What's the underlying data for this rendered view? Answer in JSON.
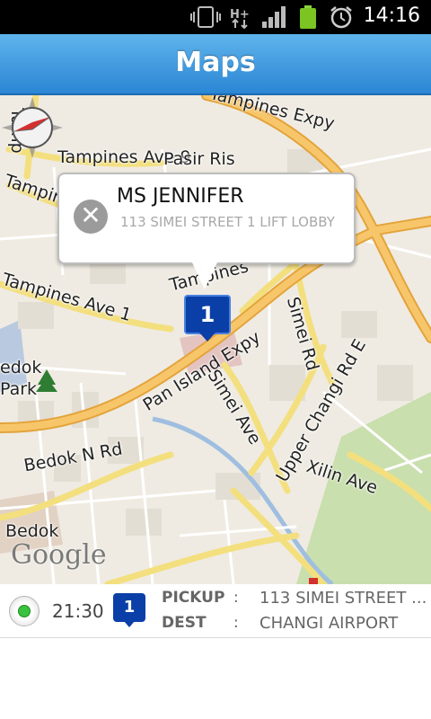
{
  "status_bar": {
    "time": "14:16"
  },
  "header": {
    "title": "Maps"
  },
  "map": {
    "labels": {
      "tampines_expy": "Tampines Expy",
      "tampines_ave9": "Tampines Ave 9",
      "pasir_ris": "Pasir Ris",
      "tampines_left": "Tampin",
      "tampines_ave1": "Tampines Ave 1",
      "tamp_mid": "Tampines",
      "pan_island": "Pan Island Expy",
      "simei_rd": "Simei Rd",
      "upper_changi": "Upper Changi Rd E",
      "simei_ave": "Simei Ave",
      "bedok_n_rd": "Bedok N Rd",
      "xilin_ave": "Xilin Ave",
      "bedok_park_1": "edok",
      "bedok_park_2": "Park",
      "bedok": "Bedok",
      "tamp_vertical": "Tamp"
    },
    "attribution": "Google",
    "callout": {
      "name": "MS JENNIFER",
      "address": "113 SIMEI STREET 1 LIFT LOBBY"
    },
    "pin_number": "1"
  },
  "job": {
    "time": "21:30",
    "badge": "1",
    "pickup_label": "PICKUP",
    "pickup_sep": ":",
    "pickup_value": "113 SIMEI STREET ...",
    "dest_label": "DEST",
    "dest_sep": ":",
    "dest_value": "CHANGI AIRPORT"
  },
  "colors": {
    "title_bar": "#2b86d4",
    "pin": "#0b3fa8",
    "status_active": "#39c23d",
    "expressway": "#f2b24a",
    "main_road": "#f6e58d"
  }
}
